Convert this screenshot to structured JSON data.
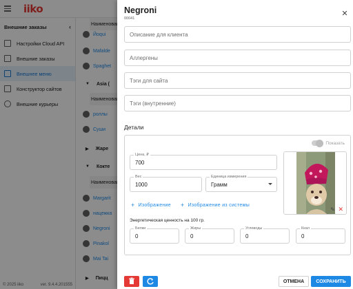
{
  "header": {
    "logo": "iiko"
  },
  "sidebar": {
    "section_title": "Внешние заказы",
    "items": [
      {
        "label": "Настройки Cloud API",
        "icon": "tool-icon"
      },
      {
        "label": "Внешние заказы",
        "icon": "list-icon"
      },
      {
        "label": "Внешнее меню",
        "icon": "book-icon",
        "active": true
      },
      {
        "label": "Конструктор сайтов",
        "icon": "monitor-icon"
      },
      {
        "label": "Внешние курьеры",
        "icon": "bicycle-icon"
      }
    ],
    "footer_copyright": "© 2025 iiko",
    "footer_version": "ver. 9.4.4.201555"
  },
  "background_list": {
    "header_top": "Наименован",
    "rows": [
      {
        "text": "Йоqui",
        "link": true
      },
      {
        "text": "Mafalde",
        "link": true
      },
      {
        "text": "Spaghet",
        "link": true
      }
    ],
    "group_asia": "Asia (",
    "header_asia": "Наименован",
    "asia_rows": [
      {
        "text": "роллы",
        "link": true
      },
      {
        "text": "Суши",
        "link": true
      }
    ],
    "group_zhar": "Жаре",
    "group_kokt": "Кокте",
    "header_kokt": "Наименован",
    "kokt_rows": [
      {
        "text": "Margarit",
        "link": true
      },
      {
        "text": "нацежка",
        "link": true
      },
      {
        "text": "Negroni",
        "link": true
      },
      {
        "text": "Pinakol",
        "link": true
      },
      {
        "text": "Mai Tai",
        "link": true
      }
    ],
    "group_pizza": "Пицц"
  },
  "drawer": {
    "title": "Negroni",
    "code": "00041",
    "fields": {
      "client_description": "Описание для клиента",
      "allergens": "Аллергены",
      "site_tags": "Тэги для сайта",
      "internal_tags": "Тэги (внутренние)"
    },
    "details_title": "Детали",
    "show_toggle_label": "Показать",
    "show_toggle_on": true,
    "price": {
      "label": "Цена, ₽",
      "value": "700"
    },
    "weight": {
      "label": "Вес",
      "value": "1000"
    },
    "unit": {
      "label": "Единица измерения",
      "value": "Грамм"
    },
    "add_image_label": "Изображение",
    "add_image_system_label": "Изображение из системы",
    "energy_title": "Энергетическая ценность на 100 гр.",
    "proteins": {
      "label": "Белки",
      "value": "0"
    },
    "fats": {
      "label": "Жиры",
      "value": "0"
    },
    "carbs": {
      "label": "Углеводы",
      "value": "0"
    },
    "kcal": {
      "label": "Ккал",
      "value": "0"
    },
    "cancel_label": "ОТМЕНА",
    "save_label": "СОХРАНИТЬ"
  },
  "colors": {
    "accent": "#1e88e5",
    "danger": "#e53935",
    "brand": "#e53935"
  }
}
